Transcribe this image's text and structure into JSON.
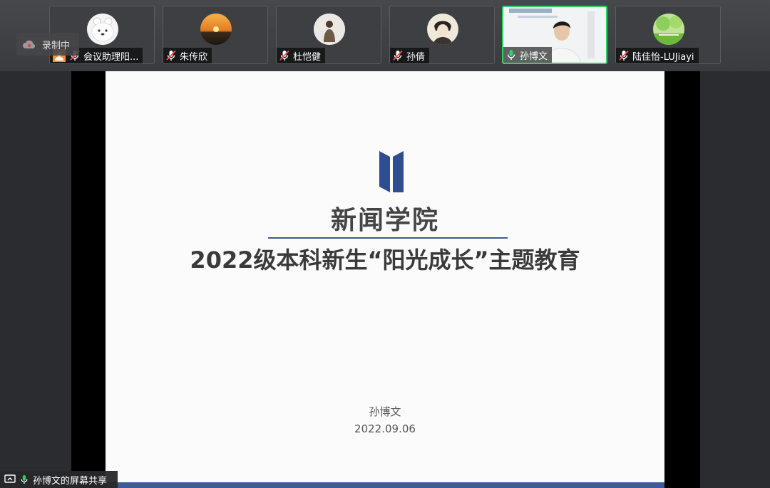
{
  "recording": {
    "label": "录制中",
    "icon": "cloud-record-icon"
  },
  "participants": [
    {
      "name": "会议助理阳...",
      "muted": true,
      "avatar": "bear-avatar",
      "host_badge": true
    },
    {
      "name": "朱传欣",
      "muted": true,
      "avatar": "sunset-avatar"
    },
    {
      "name": "杜恺健",
      "muted": true,
      "avatar": "person-avatar"
    },
    {
      "name": "孙倩",
      "muted": true,
      "avatar": "portrait-avatar"
    },
    {
      "name": "孙博文",
      "muted": false,
      "avatar": "video-feed",
      "active": true
    },
    {
      "name": "陆佳怡-LUJiayi",
      "muted": true,
      "avatar": "landscape-avatar"
    }
  ],
  "slide": {
    "title": "新闻学院",
    "subtitle": "2022级本科新生“阳光成长”主题教育",
    "presenter": "孙博文",
    "date": "2022.09.06"
  },
  "share_indicator": {
    "label": "孙博文的屏幕共享"
  },
  "colors": {
    "active_border": "#2fcf6a",
    "logo_blue": "#2f4d8f",
    "rule_blue": "#3f5a96"
  }
}
